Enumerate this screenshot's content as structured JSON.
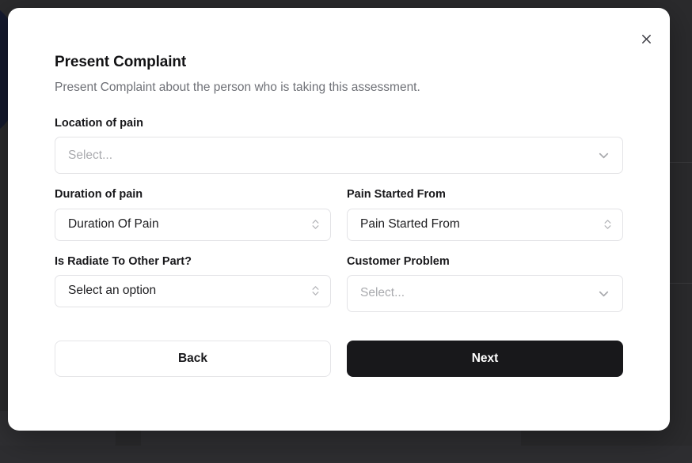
{
  "modal": {
    "title": "Present Complaint",
    "subtitle": "Present Complaint about the person who is taking this assessment.",
    "close_label": "close-icon"
  },
  "form": {
    "fields": [
      {
        "label": "Location of pain",
        "type": "searchable-select",
        "value": "",
        "placeholder": "Select...",
        "indicator": "chevron-down-icon"
      },
      {
        "label": "Duration of pain",
        "type": "native-select",
        "value": "Duration Of Pain",
        "indicator": "stepper-icon"
      },
      {
        "label": "Pain Started From",
        "type": "native-select",
        "value": "Pain Started From",
        "indicator": "stepper-icon"
      },
      {
        "label": "Is Radiate To Other Part?",
        "type": "native-select",
        "value": "Select an option",
        "indicator": "stepper-icon"
      },
      {
        "label": "Customer Problem",
        "type": "searchable-select",
        "value": "",
        "placeholder": "Select...",
        "indicator": "chevron-down-icon"
      }
    ]
  },
  "actions": {
    "back_label": "Back",
    "next_label": "Next"
  },
  "colors": {
    "primary_button": "#18181b",
    "backdrop": "#2b2b2d",
    "modal_surface": "#ffffff",
    "border": "#e3e3e6",
    "placeholder_text": "#a9aaae",
    "muted_text": "#6f7177"
  }
}
